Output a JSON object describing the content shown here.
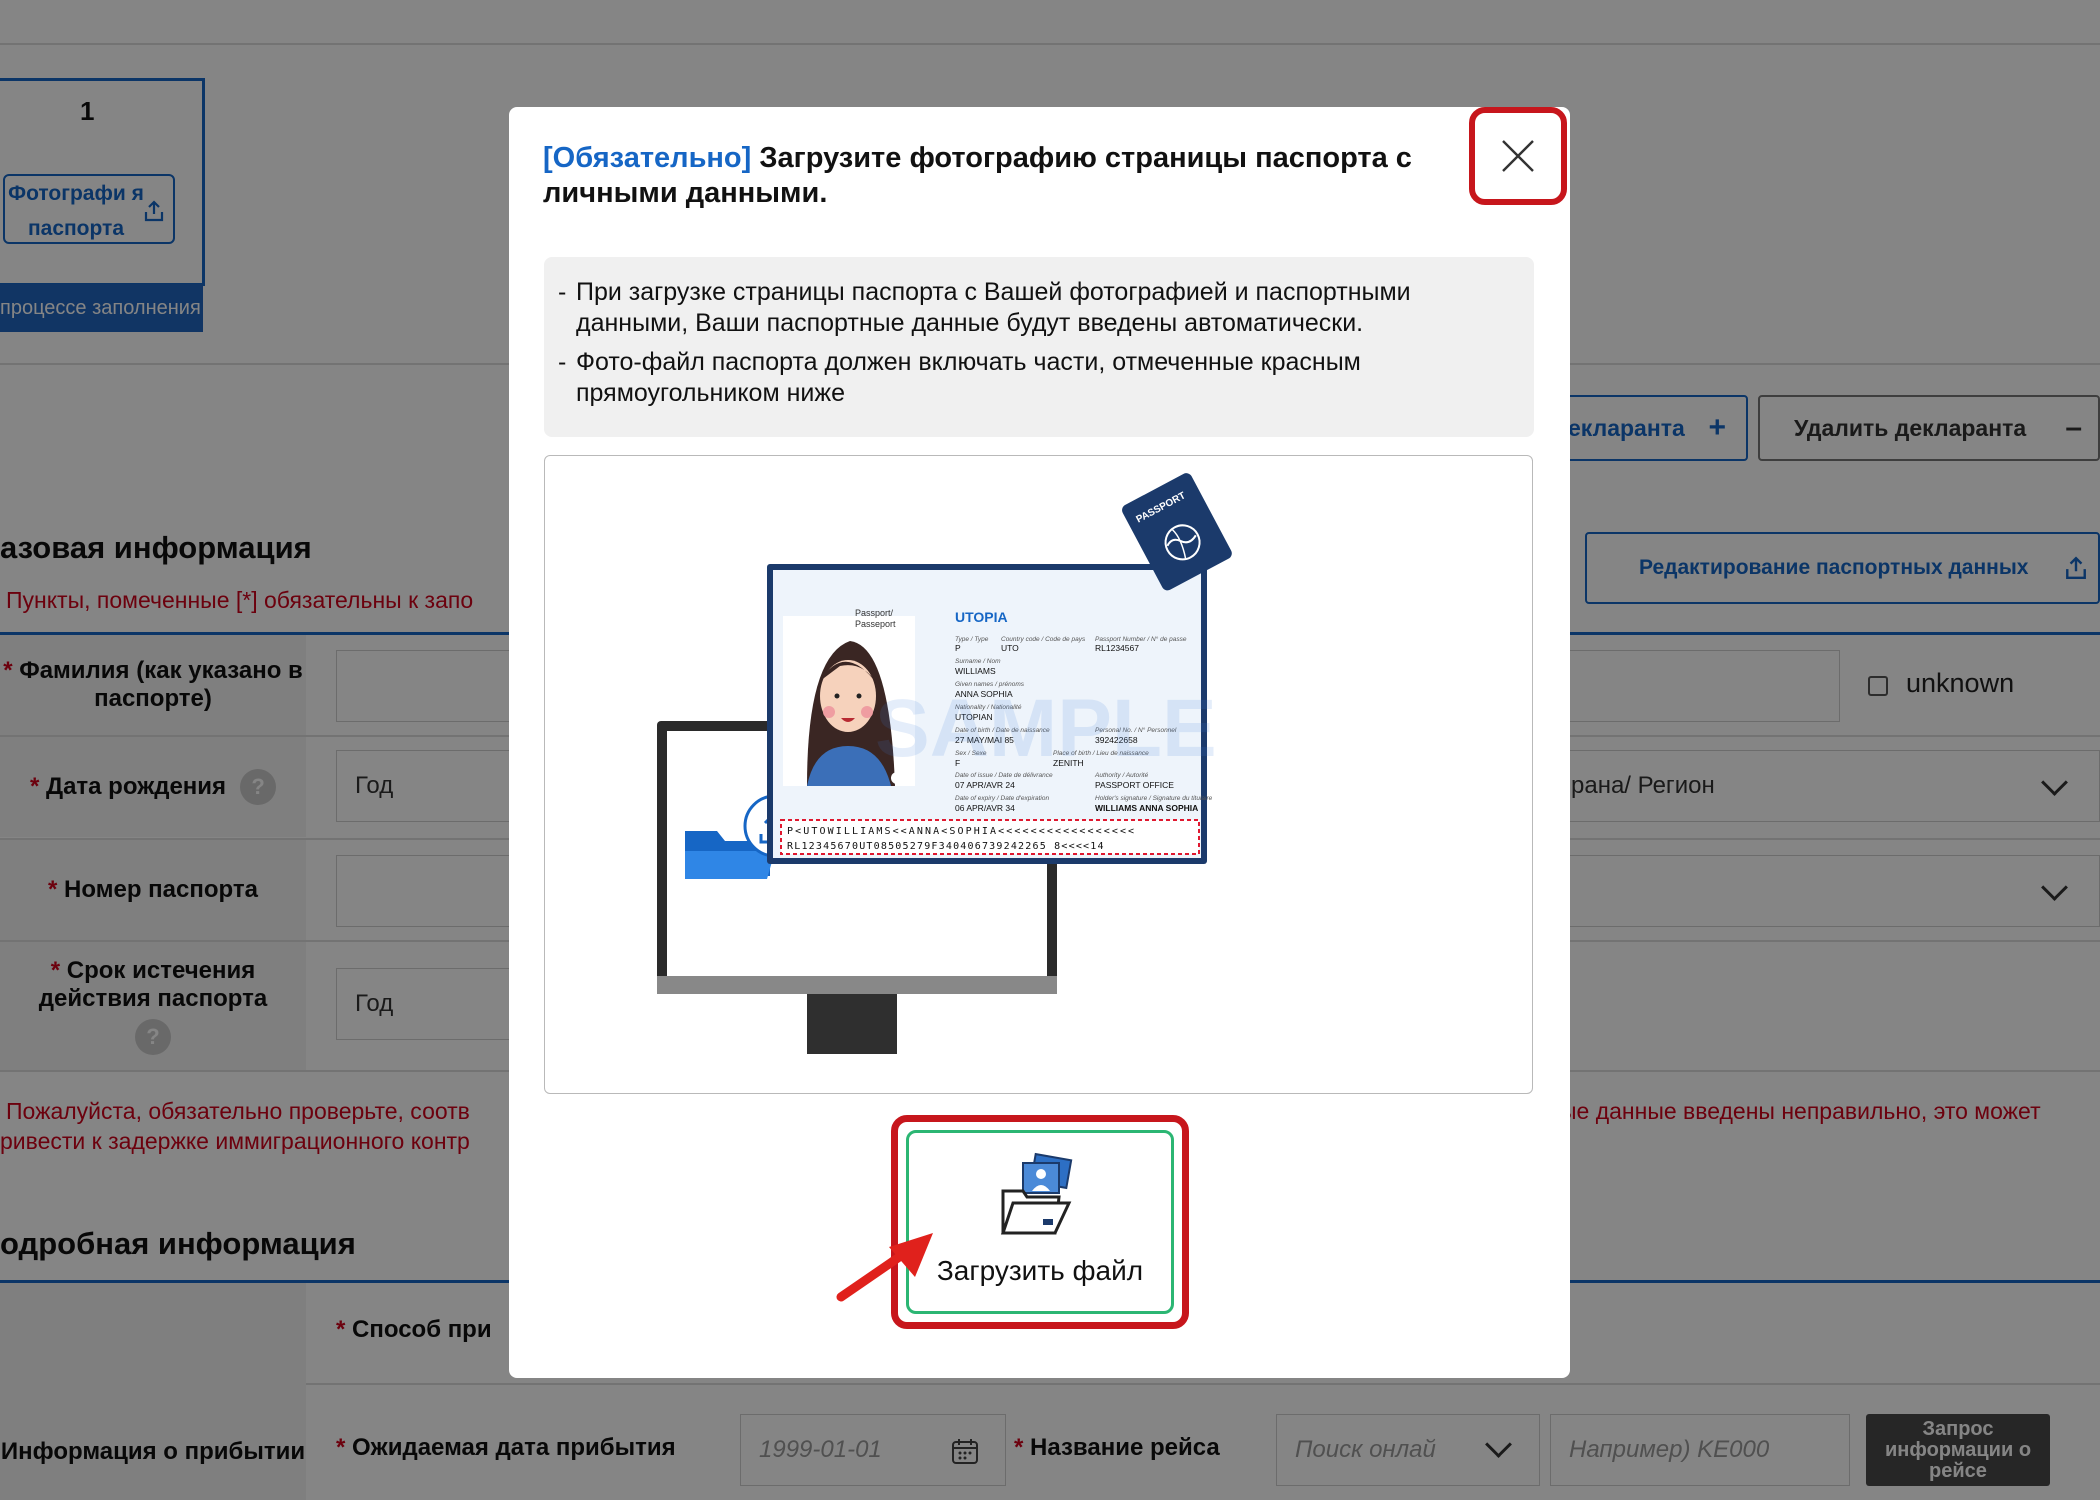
{
  "background": {
    "tab": {
      "number": "1",
      "button_label": "Фотографи я паспорта",
      "status": "процессе заполнения"
    },
    "actions": {
      "add_declarant": "екларанта",
      "delete_declarant": "Удалить декларанта",
      "edit_passport": "Редактирование паспортных данных"
    },
    "basic_section": {
      "title": "азовая информация",
      "note": "Пункты, помеченные [*] обязательны к запо"
    },
    "form": {
      "surname_label": "Фамилия (как указано в паспорте)",
      "unknown_label": "unknown",
      "birth_label": "Дата рождения",
      "year_placeholder": "Год",
      "country_placeholder": "рана/ Регион",
      "passport_number_label": "Номер паспорта",
      "expiry_label": "Срок истечения действия паспорта",
      "expiry_year": "Год"
    },
    "warning": {
      "line1_left": "Пожалуйста, обязательно проверьте, соотв",
      "line1_right": "ые данные введены неправильно, это может",
      "line2_left": "ривести к задержке иммиграционного контр"
    },
    "detail_section": {
      "title": "одробная информация"
    },
    "arrival": {
      "group_label": "Информация о прибытии",
      "method_label": "Способ при",
      "date_label": "Ожидаемая дата прибытия",
      "date_placeholder": "1999-01-01",
      "flight_label": "Название рейса",
      "search_placeholder": "Поиск онлай",
      "flight_placeholder": "Например) KE000",
      "flight_info_button": "Запрос информации о рейсе"
    },
    "required_star": "*",
    "help_glyph": "?"
  },
  "modal": {
    "title_tag": "[Обязательно]",
    "title_text": "Загрузите фотографию страницы паспорта с личными данными.",
    "info": [
      "При загрузке страницы паспорта с Вашей фотографией и паспортными данными, Ваши паспортные данные будут введены автоматически.",
      "Фото-файл паспорта должен включать части, отмеченные красным прямоугольником ниже"
    ],
    "info_dash": "-",
    "upload_label": "Загрузить файл"
  },
  "passport": {
    "passport_label_1": "Passport/",
    "passport_label_2": "Passeport",
    "country": "UTOPIA",
    "type_label": "Type / Type",
    "type": "P",
    "code_label": "Country code / Code de pays",
    "code": "UTO",
    "number_label": "Passport Number / N° de passe",
    "number": "RL1234567",
    "surname_label": "Surname / Nom",
    "surname": "WILLIAMS",
    "given_label": "Given names / prénoms",
    "given": "ANNA SOPHIA",
    "nationality_label": "Nationality / Nationalité",
    "nationality": "UTOPIAN",
    "dob_label": "Date of birth / Date de naissance",
    "dob": "27 MAY/MAI 85",
    "personal_label": "Personal No. / N° Personnel",
    "personal": "392422658",
    "sex_label": "Sex / Sexe",
    "sex": "F",
    "pob_label": "Place of birth / Lieu de naissance",
    "pob": "ZENITH",
    "issue_label": "Date of issue / Date de délivrance",
    "issue": "07 APR/AVR 24",
    "authority_label": "Authority / Autorité",
    "authority": "PASSPORT OFFICE",
    "expiry_label": "Date of expiry / Date d'expiration",
    "expiry": "06 APR/AVR 34",
    "signature_label": "Holder's signature / Signature du titulaire",
    "signature": "WILLIAMS ANNA SOPHIA",
    "watermark": "SAMPLE",
    "booklet_label": "PASSPORT",
    "mrz_line1": "P<UTOWILLIAMS<<ANNA<SOPHIA<<<<<<<<<<<<<<<<<",
    "mrz_line2": "RL12345670UT08505279F340406739242265 8<<<<14"
  },
  "colors": {
    "accent": "#1666c5",
    "danger": "#c7161c",
    "success": "#2bb673",
    "passport_navy": "#1b3a6b"
  }
}
